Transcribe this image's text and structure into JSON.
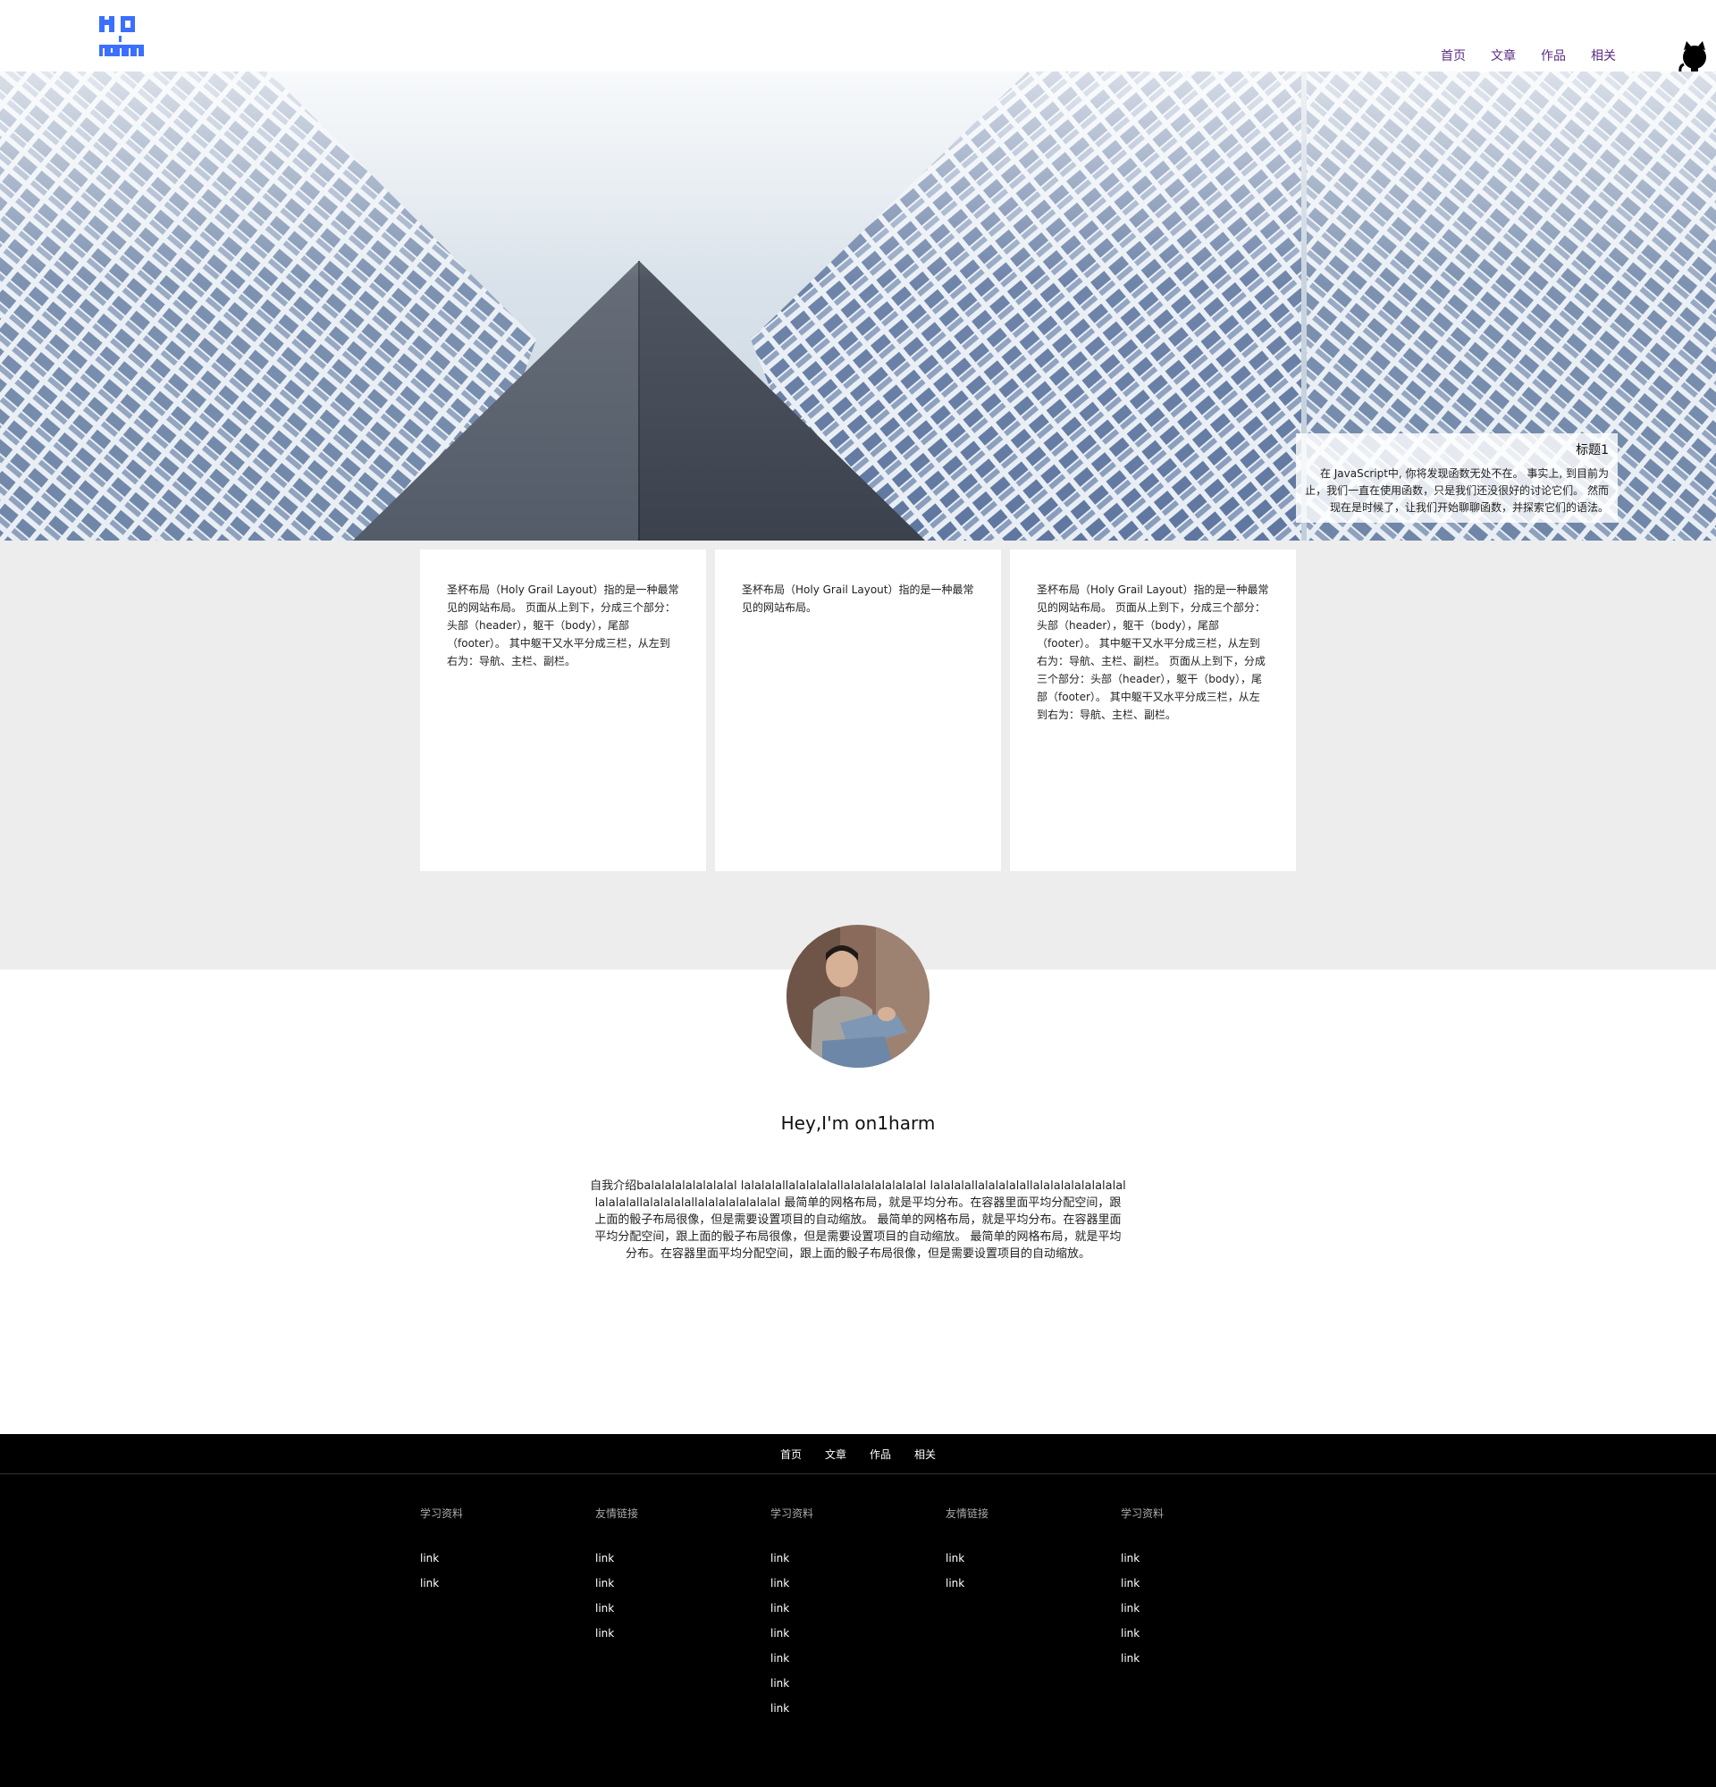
{
  "header": {
    "logo_text": "NO 1 Harm",
    "nav": [
      "首页",
      "文章",
      "作品",
      "相关"
    ]
  },
  "hero": {
    "caption_title": "标题1",
    "caption_text": "在 JavaScript中, 你将发现函数无处不在。 事实上, 到目前为止，我们一直在使用函数，只是我们还没很好的讨论它们。 然而现在是时候了，让我们开始聊聊函数，并探索它们的语法。"
  },
  "cards": [
    {
      "text": "圣杯布局（Holy Grail Layout）指的是一种最常见的网站布局。 页面从上到下，分成三个部分：头部（header），躯干（body），尾部（footer）。 其中躯干又水平分成三栏，从左到右为：导航、主栏、副栏。"
    },
    {
      "text": "圣杯布局（Holy Grail Layout）指的是一种最常见的网站布局。"
    },
    {
      "text": "圣杯布局（Holy Grail Layout）指的是一种最常见的网站布局。 页面从上到下，分成三个部分：头部（header），躯干（body），尾部（footer）。 其中躯干又水平分成三栏，从左到右为：导航、主栏、副栏。 页面从上到下，分成三个部分：头部（header），躯干（body），尾部（footer）。 其中躯干又水平分成三栏，从左到右为：导航、主栏、副栏。"
    }
  ],
  "about": {
    "title": "Hey,I'm on1harm",
    "text": "自我介绍balalalalalalalalal lalalalallalalalalallalalalalalalalal lalalalallalalalalallalalalalalalalalal lalalalallalalalalallalalalalalalalal 最简单的网格布局，就是平均分布。在容器里面平均分配空间，跟上面的骰子布局很像，但是需要设置项目的自动缩放。 最简单的网格布局，就是平均分布。在容器里面平均分配空间，跟上面的骰子布局很像，但是需要设置项目的自动缩放。 最简单的网格布局，就是平均分布。在容器里面平均分配空间，跟上面的骰子布局很像，但是需要设置项目的自动缩放。"
  },
  "footer": {
    "nav": [
      "首页",
      "文章",
      "作品",
      "相关"
    ],
    "columns": [
      {
        "title": "学习资料",
        "links": [
          "link",
          "link"
        ]
      },
      {
        "title": "友情链接",
        "links": [
          "link",
          "link",
          "link",
          "link"
        ]
      },
      {
        "title": "学习资料",
        "links": [
          "link",
          "link",
          "link",
          "link",
          "link",
          "link",
          "link"
        ]
      },
      {
        "title": "友情链接",
        "links": [
          "link",
          "link"
        ]
      },
      {
        "title": "学习资料",
        "links": [
          "link",
          "link",
          "link",
          "link",
          "link"
        ]
      }
    ]
  },
  "colors": {
    "nav_link": "#5b2c83",
    "logo_blue": "#3b6fff",
    "footer_bg": "#000000",
    "cards_bg": "#ededed"
  }
}
